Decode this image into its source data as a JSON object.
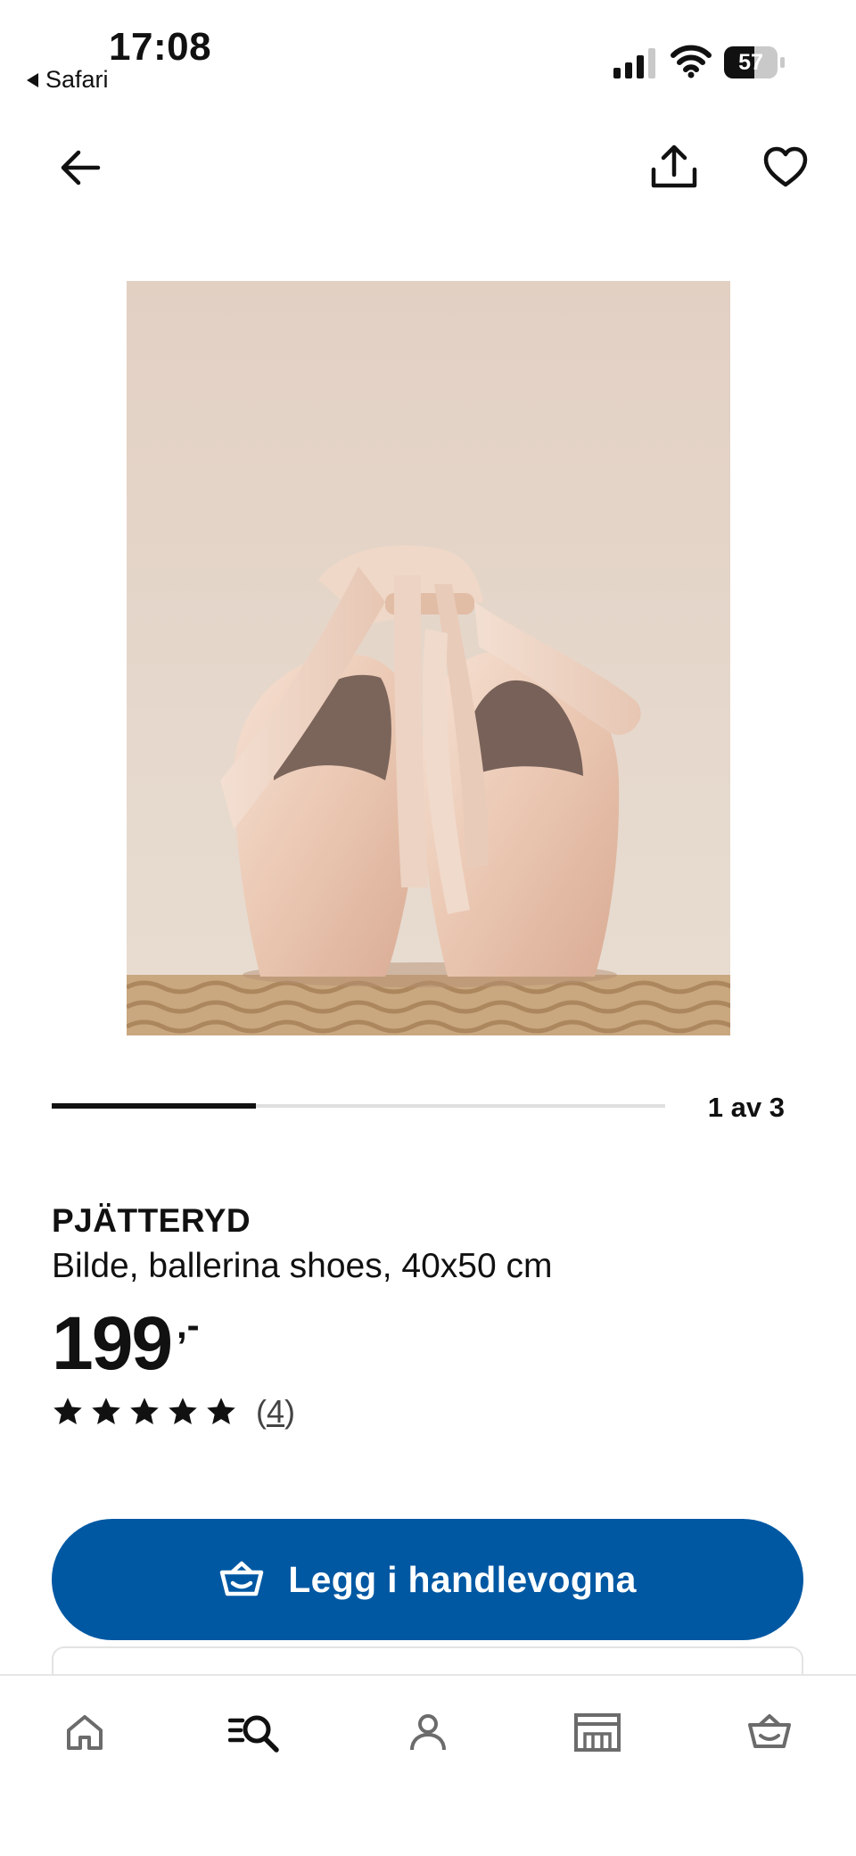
{
  "status_bar": {
    "time": "17:08",
    "back_app": "Safari",
    "battery": "57",
    "battery_level": 0.57,
    "icons": [
      "signal-icon",
      "wifi-icon",
      "battery-icon"
    ]
  },
  "top_nav": {
    "icons": [
      "arrow-left-icon",
      "share-icon",
      "heart-icon"
    ]
  },
  "carousel": {
    "counter": "1 av 3",
    "current": 1,
    "total": 3
  },
  "product": {
    "brand": "PJÄTTERYD",
    "description": "Bilde, ballerina shoes, 40x50 cm",
    "price": "199",
    "price_suffix": ",-",
    "rating": 5,
    "rating_max": 5,
    "review_prefix": "(",
    "review_count": "4",
    "review_suffix": ")"
  },
  "cta": {
    "label": "Legg i handlevogna",
    "icon": "basket-icon",
    "color": "#0058a3"
  },
  "tab_bar": {
    "items": [
      "home-icon",
      "search-list-icon",
      "account-icon",
      "store-icon",
      "basket-icon"
    ]
  }
}
